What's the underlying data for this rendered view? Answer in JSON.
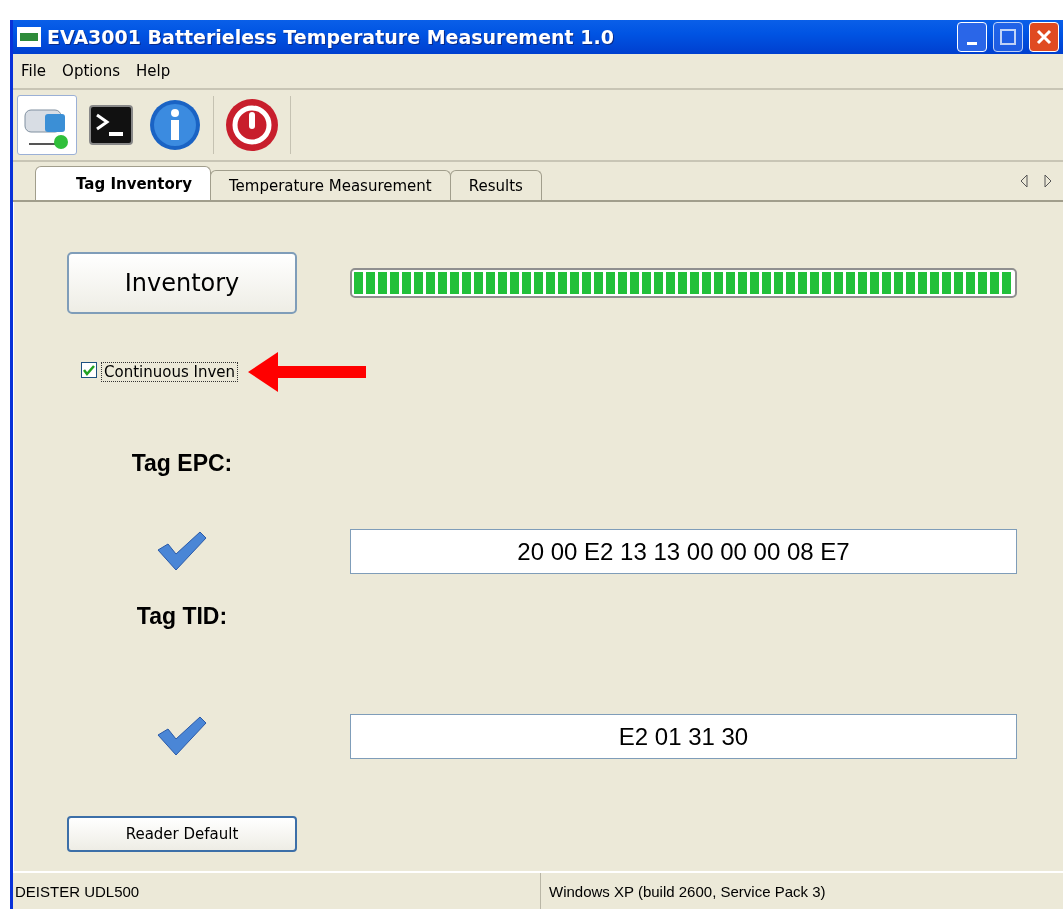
{
  "window": {
    "title": "EVA3001 Batterieless Temperature Measurement 1.0"
  },
  "menu": [
    "File",
    "Options",
    "Help"
  ],
  "toolbar": [
    {
      "kind": "device",
      "selected": true
    },
    {
      "kind": "console",
      "selected": false
    },
    {
      "kind": "info",
      "selected": false
    },
    {
      "kind": "power",
      "selected": false
    }
  ],
  "tabs": [
    {
      "label": "Tag Inventory",
      "selected": true
    },
    {
      "label": "Temperature Measurement",
      "selected": false
    },
    {
      "label": "Results",
      "selected": false
    }
  ],
  "inventory_button": "Inventory",
  "progress": {
    "level": 1.0
  },
  "continuous": {
    "label": "Continuous Inven",
    "checked": true
  },
  "fields": [
    {
      "label": "Tag EPC:",
      "value": "20 00 E2 13 13 00 00 00 08 E7",
      "ok": true
    },
    {
      "label": "Tag TID:",
      "value": "E2 01 31 30",
      "ok": true
    }
  ],
  "reader_default_button": "Reader Default",
  "status_bar": [
    "DEISTER UDL500",
    "Windows XP (build 2600, Service Pack 3)"
  ]
}
